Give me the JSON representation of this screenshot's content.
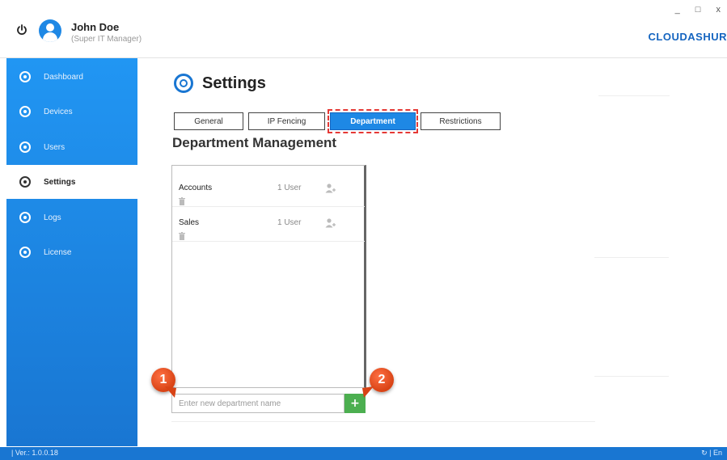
{
  "header": {
    "user_name": "John Doe",
    "user_role": "(Super IT Manager)",
    "window_controls": "_ □ x",
    "brand": "CLOUDASHUR"
  },
  "sidebar": {
    "items": [
      {
        "label": "Dashboard",
        "icon": "dashboard-icon",
        "active": false
      },
      {
        "label": "Devices",
        "icon": "devices-icon",
        "active": false
      },
      {
        "label": "Users",
        "icon": "users-icon",
        "active": false
      },
      {
        "label": "Settings",
        "icon": "settings-icon",
        "active": true
      },
      {
        "label": "Logs",
        "icon": "logs-icon",
        "active": false
      },
      {
        "label": "License",
        "icon": "license-icon",
        "active": false
      }
    ]
  },
  "main": {
    "title": "Settings",
    "tabs": [
      {
        "label": "General",
        "active": false
      },
      {
        "label": "IP Fencing",
        "active": false
      },
      {
        "label": "Department",
        "active": true
      },
      {
        "label": "Restrictions",
        "active": false
      }
    ],
    "section_title": "Department Management",
    "departments": [
      {
        "name": "Accounts",
        "count": "1 User"
      },
      {
        "name": "Sales",
        "count": "1 User"
      }
    ],
    "new_department": {
      "placeholder": "Enter new department name",
      "value": "",
      "add_label": "+"
    },
    "callouts": [
      "1",
      "2"
    ]
  },
  "footer": {
    "version": "| Ver.: 1.0.0.18",
    "right": "| En"
  },
  "colors": {
    "sidebar_top": "#2196f3",
    "sidebar_bottom": "#1976d2",
    "accent": "#1e88e5",
    "add_button": "#4caf50",
    "highlight": "#e53935",
    "callout": "#e64a19"
  }
}
